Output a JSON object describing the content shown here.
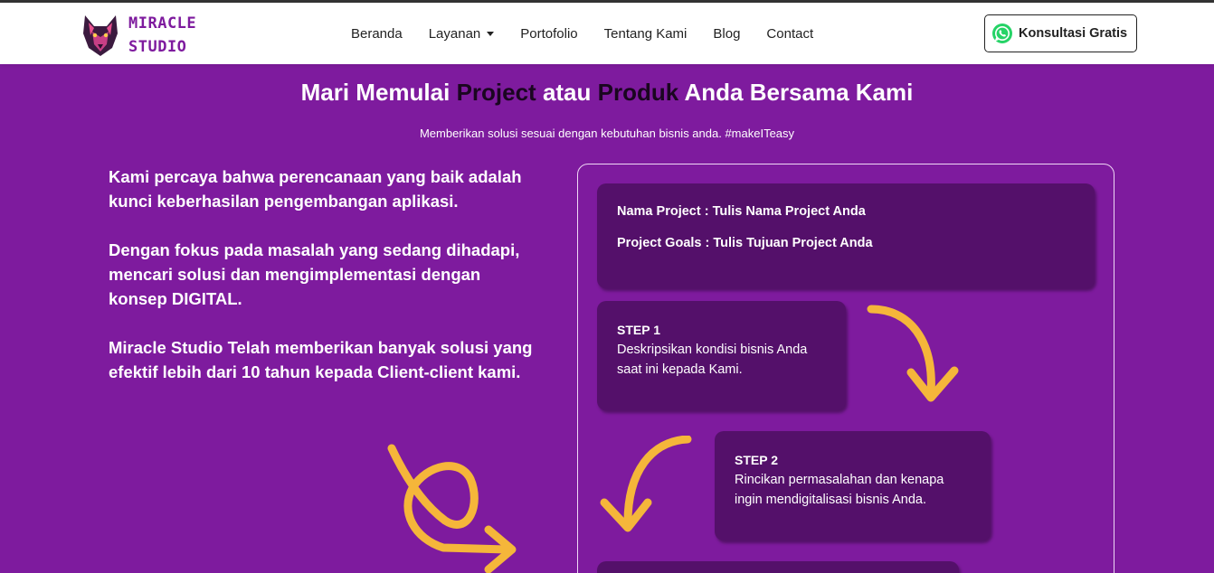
{
  "brand": {
    "line1": "MIRACLE",
    "line2": "STUDIO",
    "logo_icon": "wolf-logo-icon"
  },
  "nav": {
    "items": [
      {
        "label": "Beranda"
      },
      {
        "label": "Layanan",
        "has_dropdown": true
      },
      {
        "label": "Portofolio"
      },
      {
        "label": "Tentang Kami"
      },
      {
        "label": "Blog"
      },
      {
        "label": "Contact"
      }
    ]
  },
  "cta": {
    "label": "Konsultasi Gratis",
    "icon": "whatsapp-icon"
  },
  "hero": {
    "title_part1": "Mari Memulai ",
    "title_highlight1": "Project",
    "title_part2": " atau ",
    "title_highlight2": "Produk",
    "title_part3": " Anda Bersama Kami",
    "subtitle": "Memberikan solusi sesuai dengan kebutuhan bisnis anda. #makeITeasy"
  },
  "intro": {
    "p1": "Kami percaya bahwa perencanaan yang baik adalah kunci keberhasilan pengembangan aplikasi.",
    "p2": "Dengan fokus pada masalah yang sedang dihadapi, mencari solusi dan mengimplementasi dengan konsep DIGITAL.",
    "p3": "Miracle Studio Telah memberikan banyak solusi yang efektif lebih dari 10 tahun kepada Client-client kami."
  },
  "project_card": {
    "name_line": "Nama Project : Tulis Nama Project Anda",
    "goals_line": "Project Goals : Tulis Tujuan Project Anda"
  },
  "steps": [
    {
      "title": "STEP 1",
      "desc": "Deskripsikan kondisi bisnis Anda saat ini kepada Kami."
    },
    {
      "title": "STEP 2",
      "desc": "Rincikan permasalahan dan kenapa ingin mendigitalisasi bisnis Anda."
    }
  ],
  "colors": {
    "background": "#7e1b9e",
    "card": "#54106a",
    "accent_arrow": "#f5b63a",
    "highlight_text": "#1a0620",
    "brand_text": "#7e1b9e",
    "whatsapp": "#25d366"
  }
}
